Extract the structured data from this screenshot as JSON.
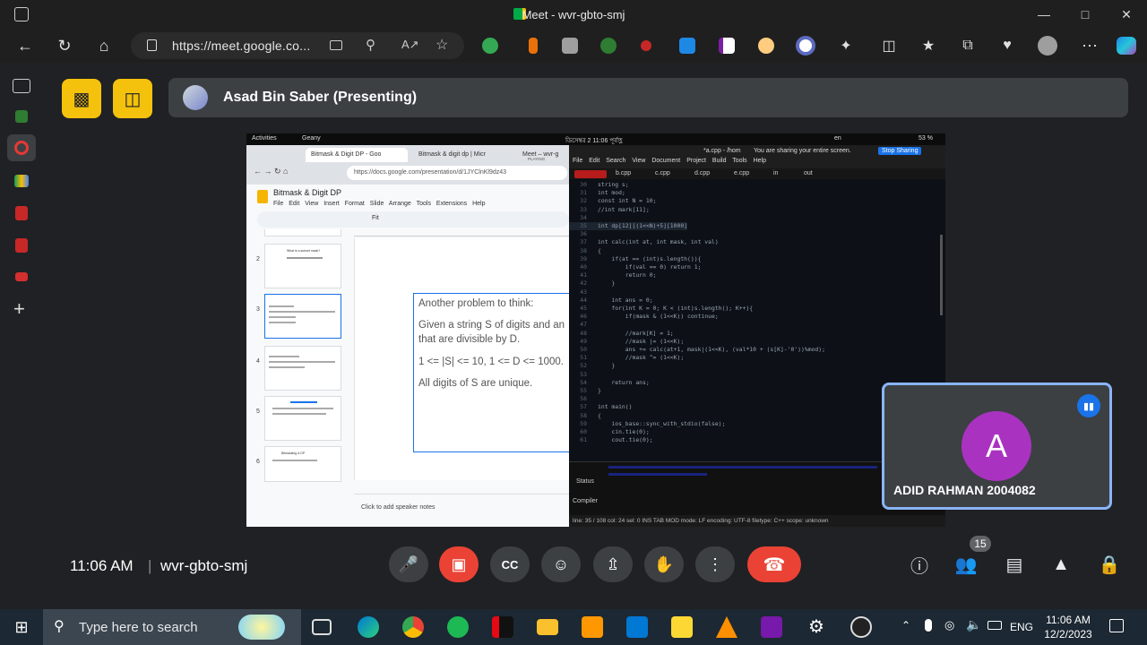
{
  "window": {
    "title": "Meet - wvr-gbto-smj"
  },
  "browser": {
    "url": "https://meet.google.co..."
  },
  "meet": {
    "presenter_name": "Asad Bin Saber (Presenting)",
    "time": "11:06 AM",
    "separator": "|",
    "meeting_code": "wvr-gbto-smj",
    "participant_count": "15",
    "participant": {
      "initial": "A",
      "name": "ADID RAHMAN 2004082"
    }
  },
  "shared_screen": {
    "topbar": {
      "activities": "Activities",
      "app": "Geany",
      "clock": "ডিসেম্বর 2  11:06 পূর্বাহ্ণ",
      "lang": "en",
      "battery": "53 %"
    },
    "chrome": {
      "tabs": [
        "Bitmask & Digit DP - Goo",
        "Bitmask & digit dp | Micr",
        "Meet – wvr-g"
      ],
      "tab_status": "PLAYING",
      "url": "https://docs.google.com/presentation/d/1JYClnKl9dz43"
    },
    "slides": {
      "doc_title": "Bitmask & Digit DP",
      "menu": "File Edit View Insert Format Slide Arrange Tools Extensions Help",
      "zoom": "Fit",
      "thumb_numbers": [
        "2",
        "3",
        "4",
        "5",
        "6"
      ],
      "thumb_titles": [
        "What is a subset mask?",
        "",
        "",
        "",
        "Bitmasking & DP"
      ],
      "slide_lines": [
        "Another problem to think:",
        "Given a string S of digits and an",
        "that are divisible by D.",
        "1 <= |S| <= 10, 1 <= D <= 1000.",
        "All digits of S are unique."
      ],
      "speaker_notes": "Click to add speaker notes"
    },
    "geany": {
      "menu": "File Edit Search View Document Project Build Tools Help",
      "sharing_note": "You are sharing your entire screen.",
      "stop_sharing": "Stop Sharing",
      "tabs": [
        "b.cpp",
        "c.cpp",
        "d.cpp",
        "e.cpp",
        "in",
        "out"
      ],
      "title": "*a.cpp - /hom",
      "code": [
        {
          "n": "30",
          "t": "string s;"
        },
        {
          "n": "31",
          "t": "int mod;"
        },
        {
          "n": "32",
          "t": "const int N = 10;"
        },
        {
          "n": "33",
          "t": "//int mark[11];"
        },
        {
          "n": "34",
          "t": ""
        },
        {
          "n": "35",
          "t": "int dp[12][(1<<N)+5][1000]"
        },
        {
          "n": "36",
          "t": ""
        },
        {
          "n": "37",
          "t": "int calc(int at, int mask, int val)"
        },
        {
          "n": "38",
          "t": "{"
        },
        {
          "n": "39",
          "t": "    if(at == (int)s.length()){"
        },
        {
          "n": "40",
          "t": "        if(val == 0) return 1;"
        },
        {
          "n": "41",
          "t": "        return 0;"
        },
        {
          "n": "42",
          "t": "    }"
        },
        {
          "n": "43",
          "t": ""
        },
        {
          "n": "44",
          "t": "    int ans = 0;"
        },
        {
          "n": "45",
          "t": "    for(int K = 0; K < (int)s.length(); K++){"
        },
        {
          "n": "46",
          "t": "        if(mask & (1<<K)) continue;"
        },
        {
          "n": "47",
          "t": ""
        },
        {
          "n": "48",
          "t": "        //mark[K] = 1;"
        },
        {
          "n": "49",
          "t": "        //mask |= (1<<K);"
        },
        {
          "n": "50",
          "t": "        ans += calc(at+1, mask|(1<<K), (val*10 + (s[K]-'0'))%mod);"
        },
        {
          "n": "51",
          "t": "        //mask ^= (1<<K);"
        },
        {
          "n": "52",
          "t": "    }"
        },
        {
          "n": "53",
          "t": ""
        },
        {
          "n": "54",
          "t": "    return ans;"
        },
        {
          "n": "55",
          "t": "}"
        },
        {
          "n": "56",
          "t": ""
        },
        {
          "n": "57",
          "t": "int main()"
        },
        {
          "n": "58",
          "t": "{"
        },
        {
          "n": "59",
          "t": "    ios_base::sync_with_stdio(false);"
        },
        {
          "n": "60",
          "t": "    cin.tie(0);"
        },
        {
          "n": "61",
          "t": "    cout.tie(0);"
        }
      ],
      "panel_labels": [
        "Status",
        "Compiler"
      ],
      "statusbar": "line: 35 / 108    col: 24  sel: 0    INS    TAB    MOD    mode: LF    encoding: UTF-8    filetype: C++    scope: unknown"
    }
  },
  "taskbar": {
    "search_placeholder": "Type here to search",
    "lang": "ENG",
    "time": "11:06 AM",
    "date": "12/2/2023"
  }
}
